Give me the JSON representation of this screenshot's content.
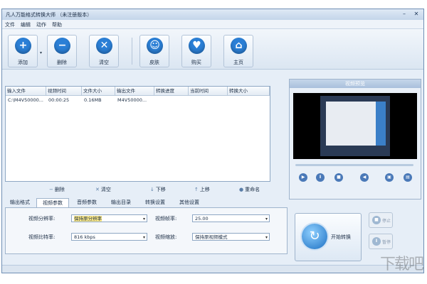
{
  "window": {
    "title": "凡人万能格式转换大师 （未注册版本）",
    "controls": [
      "–",
      "✕"
    ]
  },
  "menu": [
    "文件",
    "编辑",
    "动作",
    "帮助"
  ],
  "toolbar": {
    "dropdown_glyph": "▾",
    "buttons": [
      {
        "label": "添加",
        "glyph": "+",
        "icon": "add-icon",
        "color": "#2b7fd6"
      },
      {
        "label": "删除",
        "glyph": "−",
        "icon": "remove-icon",
        "color": "#2b7fd6"
      },
      {
        "label": "清空",
        "glyph": "✕",
        "icon": "clear-icon",
        "color": "#2b7fd6"
      },
      {
        "label": "皮肤",
        "glyph": "☺",
        "icon": "skin-icon",
        "color": "#2b7fd6"
      },
      {
        "label": "购买",
        "glyph": "♥",
        "icon": "cart-icon",
        "color": "#2b7fd6"
      },
      {
        "label": "主页",
        "glyph": "⌂",
        "icon": "home-icon",
        "color": "#2b7fd6"
      }
    ]
  },
  "file_table": {
    "columns": [
      "输入文件",
      "视频时间",
      "文件大小",
      "输出文件",
      "转换进度",
      "当前时间",
      "转换大小"
    ],
    "rows": [
      [
        "C:\\M4V50000...",
        "00:00:25",
        "0.16MB",
        "M4V50000...",
        "",
        "",
        ""
      ]
    ]
  },
  "list_actions": [
    {
      "label": "删除",
      "glyph": "−",
      "icon": "delete-icon"
    },
    {
      "label": "清空",
      "glyph": "✕",
      "icon": "clear-list-icon"
    },
    {
      "label": "下移",
      "glyph": "↓",
      "icon": "move-down-icon"
    },
    {
      "label": "上移",
      "glyph": "↑",
      "icon": "move-up-icon"
    },
    {
      "label": "重命名",
      "glyph": "●",
      "icon": "rename-icon"
    }
  ],
  "tabs": [
    "输出格式",
    "视频参数",
    "音频参数",
    "输出目录",
    "转换设置",
    "其他设置"
  ],
  "active_tab": 1,
  "video_params": {
    "resolution_label": "视频分辨率:",
    "resolution_value": "保持原分辨率",
    "framerate_label": "视频帧率:",
    "framerate_value": "25.00",
    "bitrate_label": "视频比特率:",
    "bitrate_value": "816 kbps",
    "scale_label": "视频缩放:",
    "scale_value": "保持原视频模式",
    "dropdown_glyph": "▾"
  },
  "preview": {
    "title": "视频预览",
    "controls": [
      {
        "glyph": "▶",
        "icon": "play-icon"
      },
      {
        "glyph": "Ⅱ",
        "icon": "pause-icon"
      },
      {
        "glyph": "■",
        "icon": "stop-icon"
      },
      {
        "glyph": "◀",
        "icon": "volume-icon"
      },
      {
        "glyph": "▣",
        "icon": "snapshot-icon"
      },
      {
        "glyph": "▤",
        "icon": "fullscreen-icon"
      }
    ]
  },
  "actions": {
    "start_label": "开始转换",
    "start_glyph": "↻",
    "stop_label": "停止",
    "stop_glyph": "■",
    "pause_label": "暂停",
    "pause_glyph": "Ⅱ"
  },
  "watermark": "下载吧"
}
